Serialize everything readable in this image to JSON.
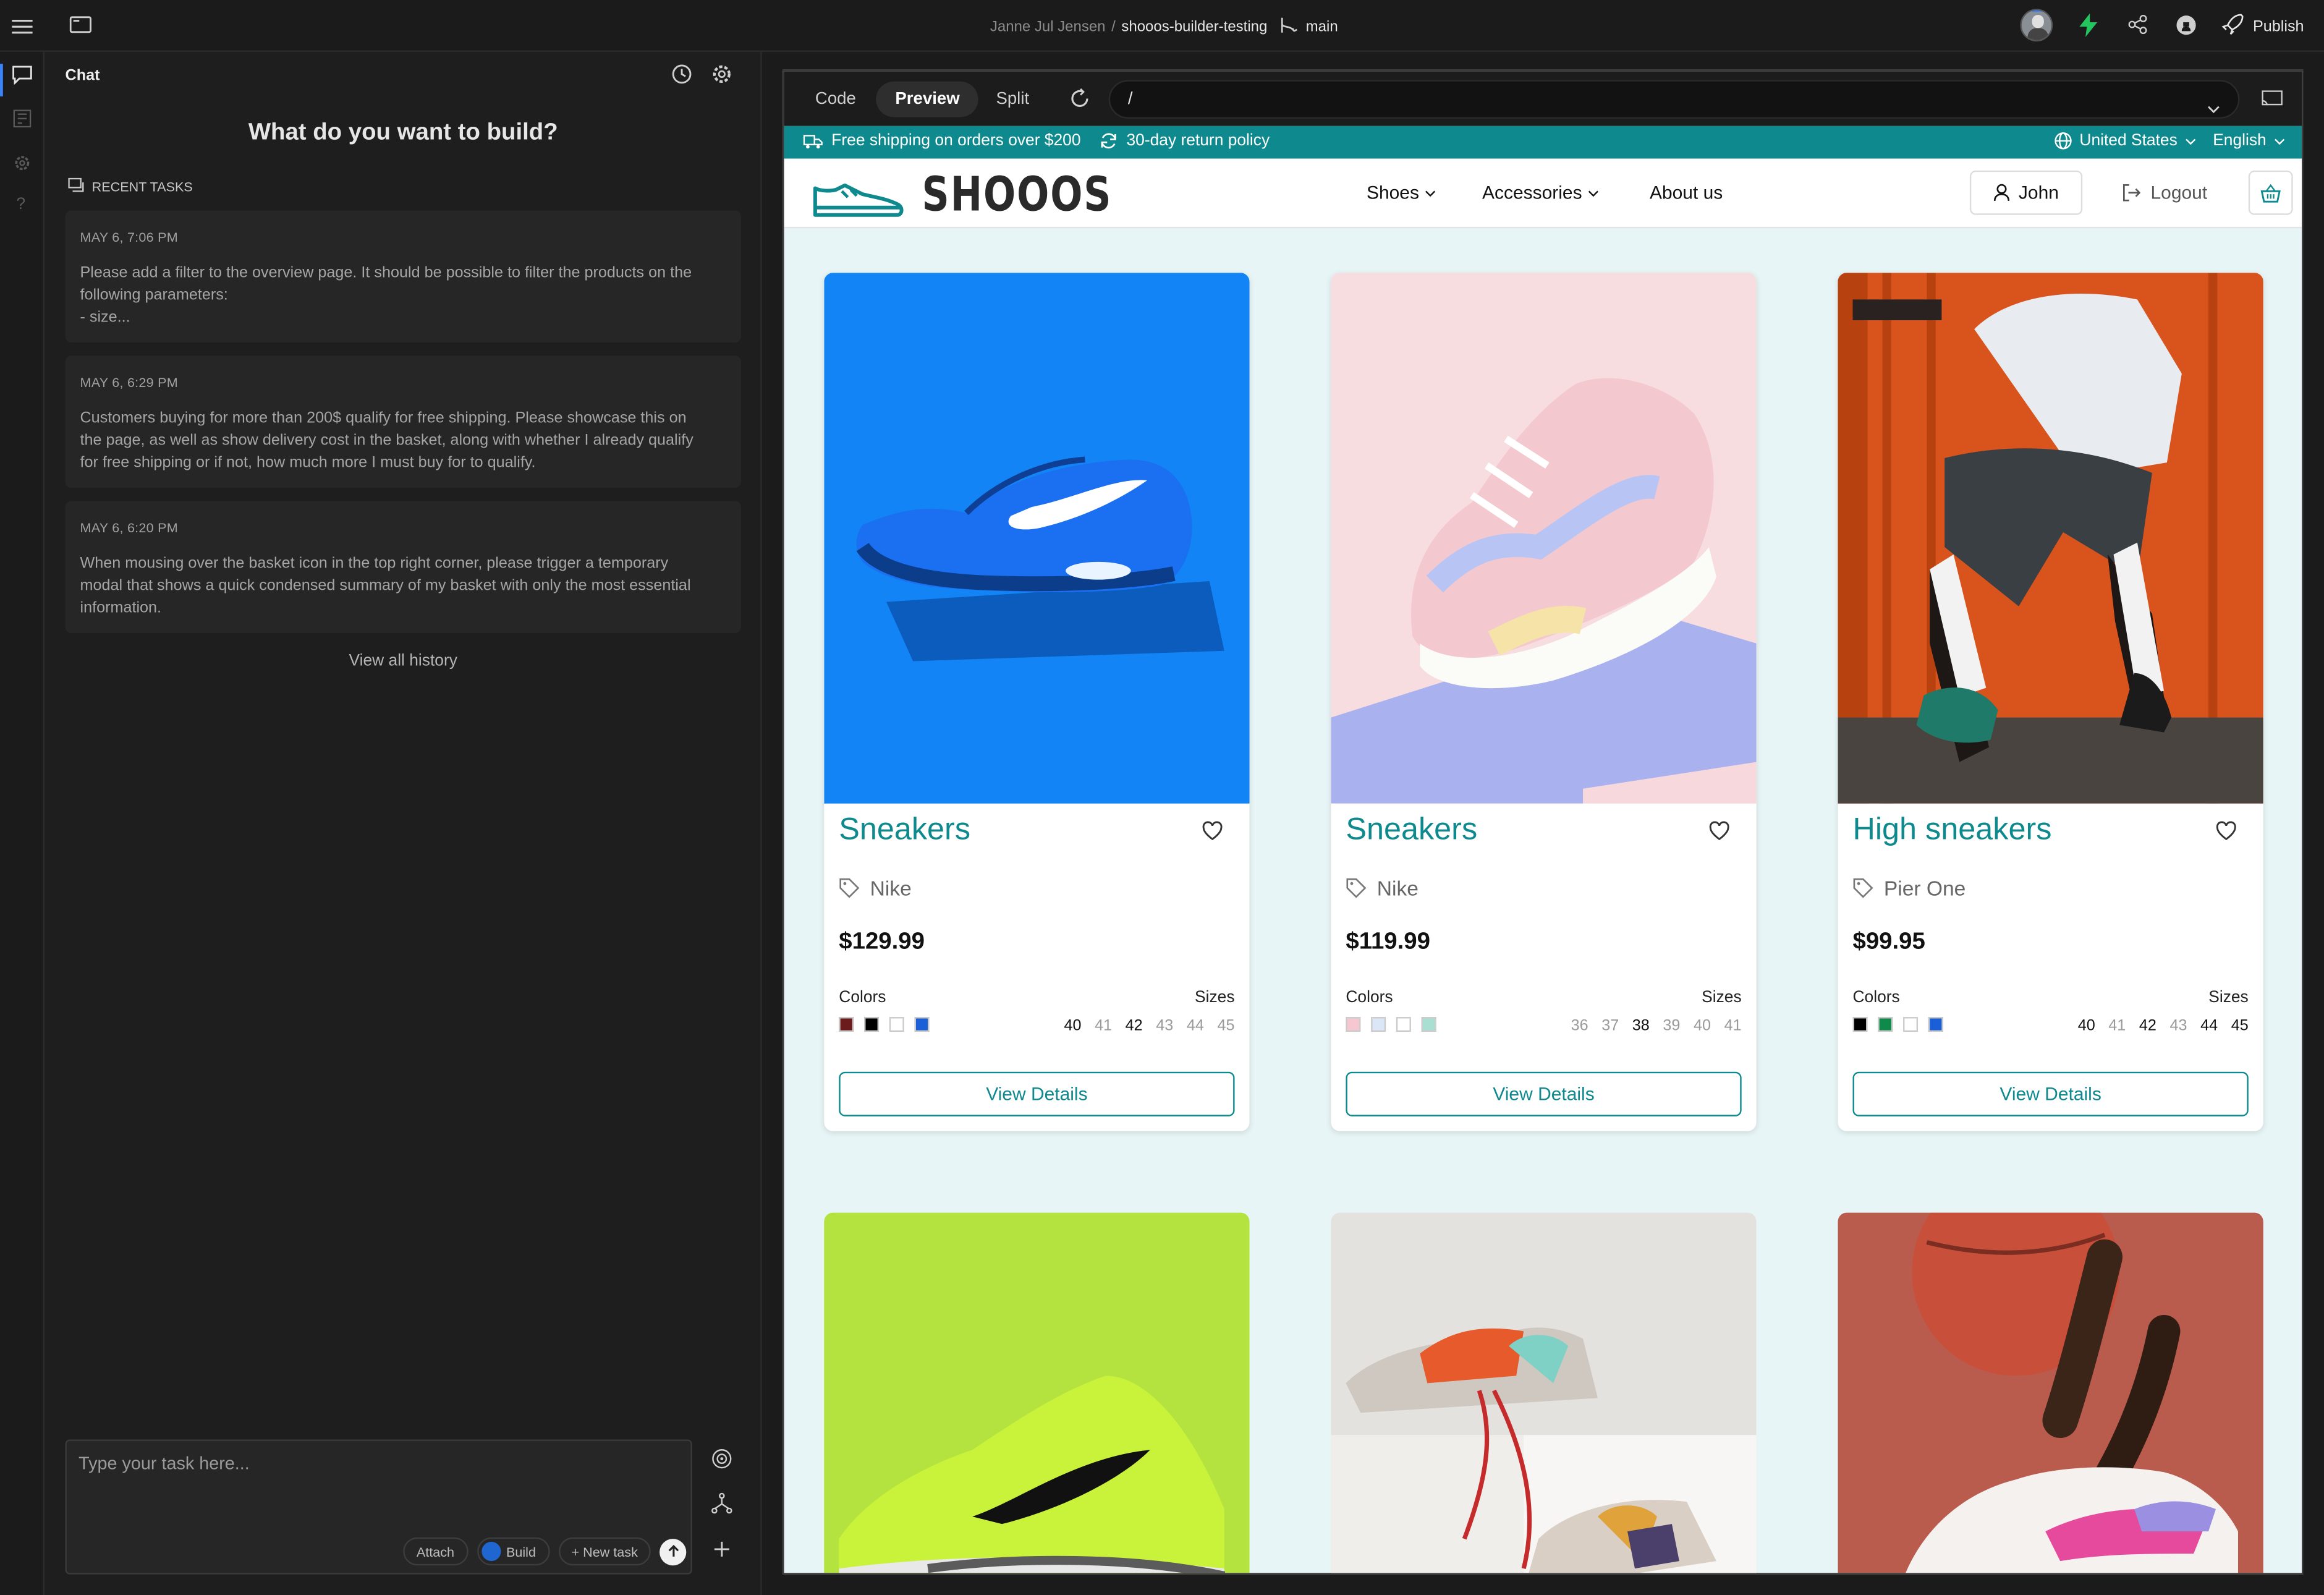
{
  "topbar": {
    "user": "Janne Jul Jensen",
    "separator": "/",
    "project": "shooos-builder-testing",
    "branch": "main",
    "publish_label": "Publish"
  },
  "chat": {
    "title": "Chat",
    "heading": "What do you want to build?",
    "recent_label": "RECENT TASKS",
    "tasks": [
      {
        "date": "MAY 6, 7:06 PM",
        "lines": [
          "Please add a filter to the overview page. It should be possible to filter the products on the",
          "following parameters:",
          "- size..."
        ]
      },
      {
        "date": "MAY 6, 6:29 PM",
        "lines": [
          "Customers buying for more than 200$ qualify for free shipping. Please showcase this on",
          "the page, as well as show delivery cost in the basket, along with whether I already qualify",
          "for free shipping or if not, how much more I must buy for to qualify."
        ]
      },
      {
        "date": "MAY 6, 6:20 PM",
        "lines": [
          "When mousing over the basket icon in the top right corner, please trigger a temporary",
          "modal that shows a quick condensed summary of my basket with only the most essential",
          "information."
        ]
      }
    ],
    "view_all": "View all history",
    "input_placeholder": "Type your task here...",
    "attach": "Attach",
    "build": "Build",
    "new_task": "+ New task"
  },
  "preview_toolbar": {
    "tabs": [
      "Code",
      "Preview",
      "Split"
    ],
    "active_tab": "Preview",
    "url": "/"
  },
  "shop": {
    "shipping": "Free shipping on orders over $200",
    "returns": "30-day return policy",
    "country": "United States",
    "language": "English",
    "logo": "SHOOOS",
    "nav": [
      "Shoes",
      "Accessories",
      "About us"
    ],
    "user": "John",
    "logout": "Logout",
    "colors_label": "Colors",
    "sizes_label": "Sizes",
    "cta": "View Details",
    "colors": {
      "teal": "#0e8a8f"
    },
    "products": [
      {
        "name": "Sneakers",
        "brand": "Nike",
        "price": "$129.99",
        "swatches": [
          "#6b1b1b",
          "#000000",
          "#ffffff",
          "#1a5fd8"
        ],
        "sizes": [
          {
            "s": "40",
            "a": true
          },
          {
            "s": "41",
            "a": false
          },
          {
            "s": "42",
            "a": true
          },
          {
            "s": "43",
            "a": false
          },
          {
            "s": "44",
            "a": false
          },
          {
            "s": "45",
            "a": false
          }
        ]
      },
      {
        "name": "Sneakers",
        "brand": "Nike",
        "price": "$119.99",
        "swatches": [
          "#f6c7d0",
          "#dbe6f7",
          "#ffffff",
          "#a9dfd2"
        ],
        "sizes": [
          {
            "s": "36",
            "a": false
          },
          {
            "s": "37",
            "a": false
          },
          {
            "s": "38",
            "a": true
          },
          {
            "s": "39",
            "a": false
          },
          {
            "s": "40",
            "a": false
          },
          {
            "s": "41",
            "a": false
          }
        ]
      },
      {
        "name": "High sneakers",
        "brand": "Pier One",
        "price": "$99.95",
        "swatches": [
          "#000000",
          "#0f8a4a",
          "#ffffff",
          "#1a5fd8"
        ],
        "sizes": [
          {
            "s": "40",
            "a": true
          },
          {
            "s": "41",
            "a": false
          },
          {
            "s": "42",
            "a": true
          },
          {
            "s": "43",
            "a": false
          },
          {
            "s": "44",
            "a": true
          },
          {
            "s": "45",
            "a": true
          }
        ]
      }
    ]
  }
}
